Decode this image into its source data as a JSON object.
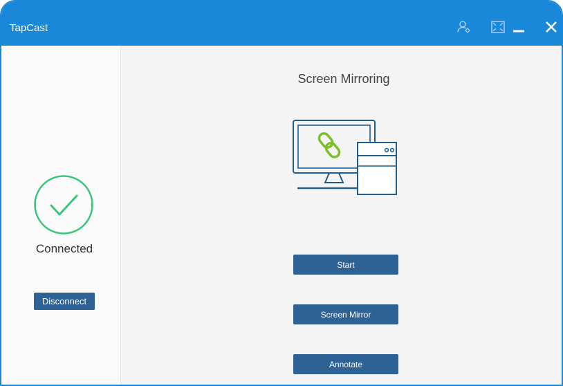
{
  "app": {
    "title": "TapCast"
  },
  "titlebar": {
    "buttons": [
      {
        "icon": "user-settings-icon"
      },
      {
        "icon": "fullscreen-icon"
      },
      {
        "icon": "minimize-icon"
      },
      {
        "icon": "close-icon"
      }
    ]
  },
  "sidebar": {
    "status_icon": "checkmark-circle-icon",
    "status_color": "#3cc47c",
    "status_text": "Connected",
    "disconnect_label": "Disconnect"
  },
  "main": {
    "title": "Screen Mirroring",
    "illustration_icon": "computer-link-icon",
    "link_color": "#7cbf2a",
    "device_color": "#1f5d8f",
    "buttons": {
      "start_label": "Start",
      "screen_mirror_label": "Screen Mirror",
      "annotate_label": "Annotate"
    }
  },
  "colors": {
    "titlebar": "#1a88d9",
    "button": "#2e6294"
  }
}
